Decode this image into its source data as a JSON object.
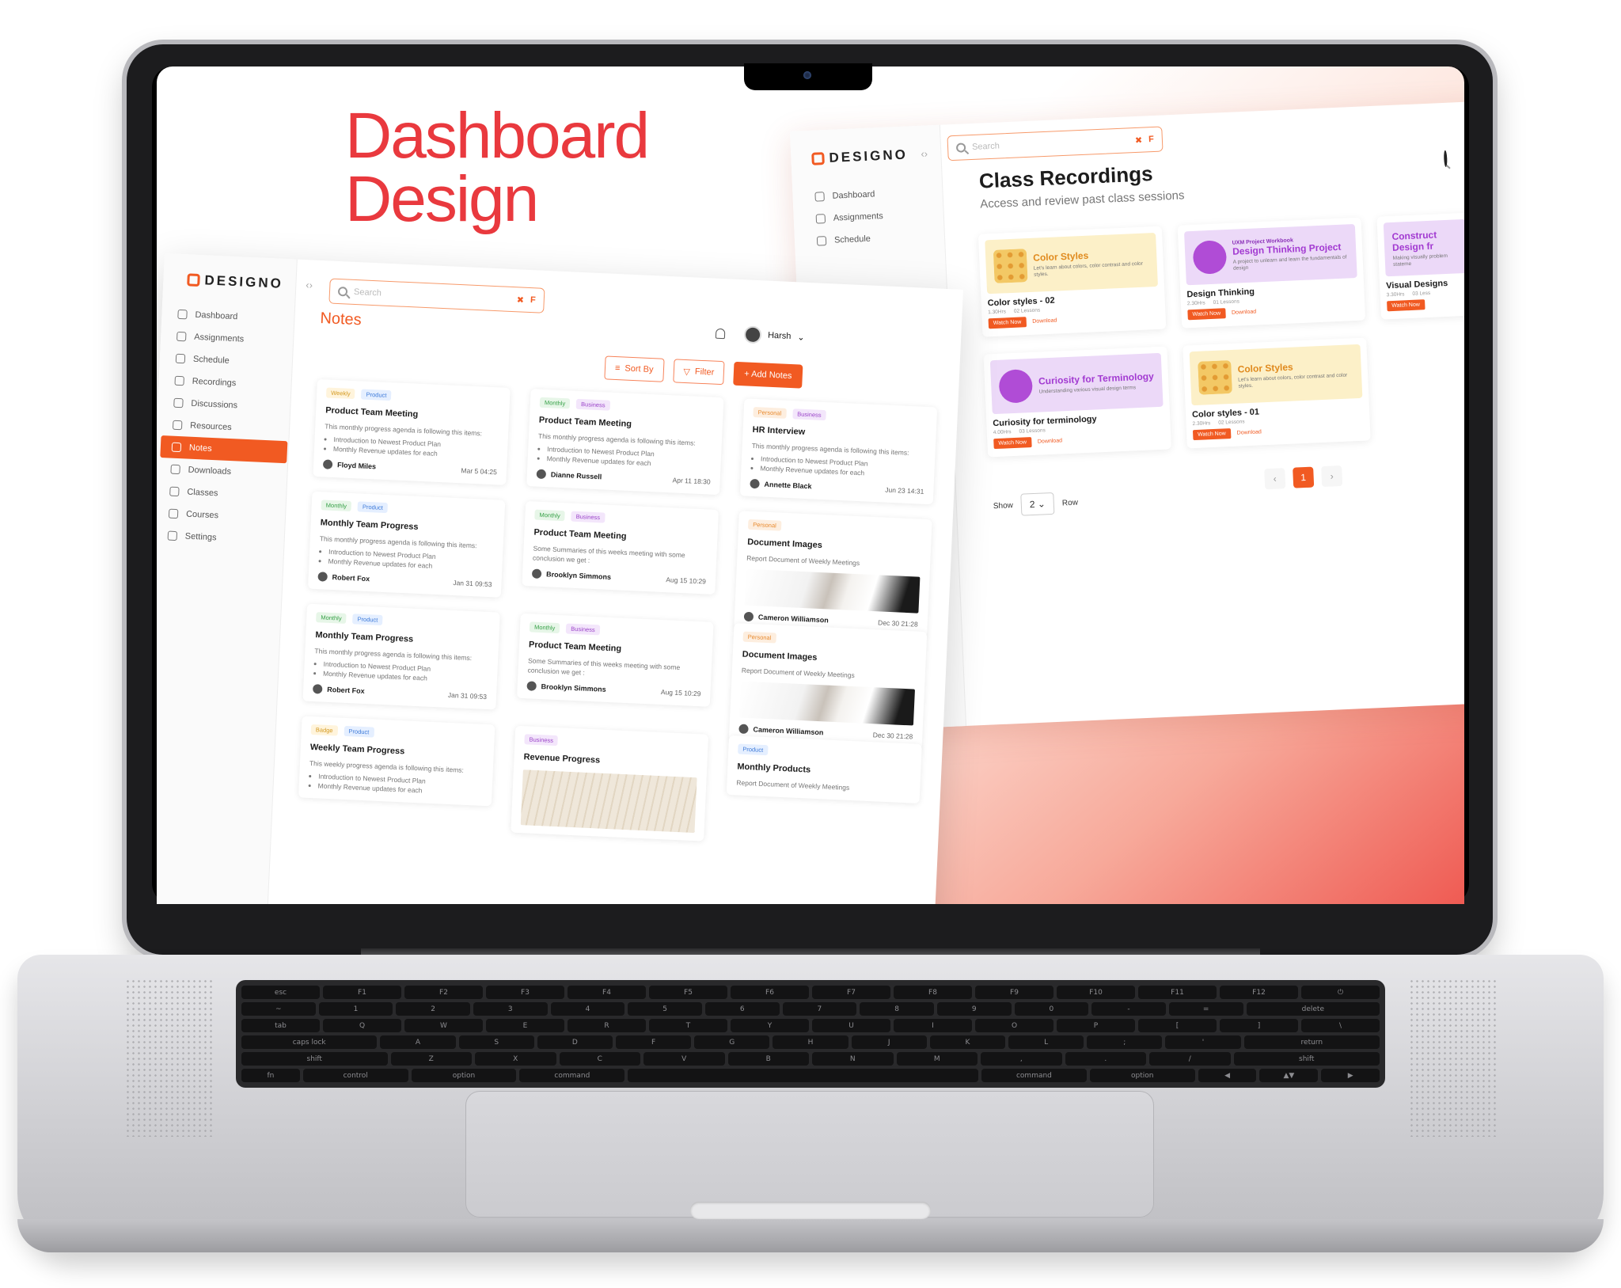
{
  "hero": {
    "line1": "Dashboard",
    "line2": "Design"
  },
  "brand": {
    "name": "DESIGNO",
    "accent": "#f15a22",
    "hero_color": "#e9393e"
  },
  "search": {
    "placeholder": "Search",
    "clear": "✖",
    "shortcut": "F"
  },
  "recordings": {
    "nav": [
      "Dashboard",
      "Assignments",
      "Schedule"
    ],
    "title": "Class Recordings",
    "subtitle": "Access and review past class sessions",
    "cards": [
      {
        "thumb_title": "Color Styles",
        "thumb_desc": "Let's learn about colors, color contrast and color styles.",
        "name": "Color styles - 02",
        "duration": "1.30Hrs",
        "lessons": "02 Lessons",
        "watch": "Watch Now",
        "download": "Download",
        "theme": "yellow"
      },
      {
        "thumb_top": "UXM Project Workbook",
        "thumb_title": "Design Thinking Project",
        "thumb_desc": "A project to unlearn and learn the fundamentals of design",
        "name": "Design Thinking",
        "duration": "2.30Hrs",
        "lessons": "01 Lessons",
        "watch": "Watch Now",
        "download": "Download",
        "theme": "purple"
      },
      {
        "thumb_title": "Construct Design fr",
        "thumb_desc": "Making visually problem stateme",
        "name": "Visual Designs",
        "duration": "3.30Hrs",
        "lessons": "03 Less",
        "watch": "Watch Now",
        "download": "",
        "theme": "purple"
      },
      {
        "thumb_title": "Curiosity for Terminology",
        "thumb_desc": "Understanding various visual design terms",
        "name": "Curiosity for terminology",
        "duration": "4.00Hrs",
        "lessons": "03 Lessons",
        "watch": "Watch Now",
        "download": "Download",
        "theme": "purple"
      },
      {
        "thumb_title": "Color Styles",
        "thumb_desc": "Let's learn about colors, color contrast and color styles.",
        "name": "Color styles - 01",
        "duration": "2.30Hrs",
        "lessons": "02 Lessons",
        "watch": "Watch Now",
        "download": "Download",
        "theme": "yellow"
      }
    ],
    "pager": {
      "prev": "‹",
      "current": "1",
      "next": "›"
    },
    "show": {
      "label": "Show",
      "value": "2",
      "suffix": "Row"
    }
  },
  "notes": {
    "title": "Notes",
    "user": "Harsh",
    "sort": "Sort By",
    "filter": "Filter",
    "add": "+ Add Notes",
    "nav": [
      {
        "label": "Dashboard",
        "icon": "clock-icon",
        "active": false
      },
      {
        "label": "Assignments",
        "icon": "clipboard-icon",
        "active": false
      },
      {
        "label": "Schedule",
        "icon": "calendar-icon",
        "active": false
      },
      {
        "label": "Recordings",
        "icon": "video-icon",
        "active": false
      },
      {
        "label": "Discussions",
        "icon": "chat-icon",
        "active": false
      },
      {
        "label": "Resources",
        "icon": "folder-icon",
        "active": false
      },
      {
        "label": "Notes",
        "icon": "note-icon",
        "active": true
      },
      {
        "label": "Downloads",
        "icon": "download-icon",
        "active": false
      },
      {
        "label": "Classes",
        "icon": "users-icon",
        "active": false
      },
      {
        "label": "Courses",
        "icon": "graduation-icon",
        "active": false
      },
      {
        "label": "Settings",
        "icon": "gear-icon",
        "active": false
      }
    ],
    "items": [
      {
        "tags": [
          "Weekly",
          "Product"
        ],
        "title": "Product Team Meeting",
        "body": "This monthly progress agenda is following this items:",
        "bullets": [
          "Introduction to Newest Product Plan",
          "Monthly Revenue updates for each"
        ],
        "author": "Floyd Miles",
        "date": "Mar 5 04:25"
      },
      {
        "tags": [
          "Monthly",
          "Business"
        ],
        "title": "Product Team Meeting",
        "body": "This monthly progress agenda is following this items:",
        "bullets": [
          "Introduction to Newest Product Plan",
          "Monthly Revenue updates for each"
        ],
        "author": "Dianne Russell",
        "date": "Apr 11 18:30"
      },
      {
        "tags": [
          "Personal",
          "Business"
        ],
        "title": "HR Interview",
        "body": "This monthly progress agenda is following this items:",
        "bullets": [
          "Introduction to Newest Product Plan",
          "Monthly Revenue updates for each"
        ],
        "author": "Annette Black",
        "date": "Jun 23 14:31"
      },
      {
        "tags": [
          "Monthly",
          "Product"
        ],
        "title": "Monthly Team Progress",
        "body": "This monthly progress agenda is following this items:",
        "bullets": [
          "Introduction to Newest Product Plan",
          "Monthly Revenue updates for each"
        ],
        "author": "Robert Fox",
        "date": "Jan 31 09:53"
      },
      {
        "tags": [
          "Monthly",
          "Business"
        ],
        "title": "Product Team Meeting",
        "body": "Some Summaries of this weeks meeting with some conclusion we get :",
        "bullets": [],
        "author": "Brooklyn Simmons",
        "date": "Aug 15 10:29"
      },
      {
        "tags": [
          "Personal"
        ],
        "title": "Document Images",
        "body": "Report Document of Weekly Meetings",
        "bullets": [],
        "author": "Cameron Williamson",
        "date": "Dec 30 21:28"
      },
      {
        "tags": [
          "Monthly",
          "Product"
        ],
        "title": "Monthly Team Progress",
        "body": "This monthly progress agenda is following this items:",
        "bullets": [
          "Introduction to Newest Product Plan",
          "Monthly Revenue updates for each"
        ],
        "author": "Robert Fox",
        "date": "Jan 31 09:53"
      },
      {
        "tags": [
          "Monthly",
          "Business"
        ],
        "title": "Product Team Meeting",
        "body": "Some Summaries of this weeks meeting with some conclusion we get :",
        "bullets": [],
        "author": "Brooklyn Simmons",
        "date": "Aug 15 10:29"
      },
      {
        "tags": [
          "Personal"
        ],
        "title": "Document Images",
        "body": "Report Document of Weekly Meetings",
        "bullets": [],
        "author": "Cameron Williamson",
        "date": "Dec 30 21:28"
      },
      {
        "tags": [
          "Badge",
          "Product"
        ],
        "title": "Weekly Team Progress",
        "body": "This weekly progress agenda is following this items:",
        "bullets": [
          "Introduction to Newest Product Plan",
          "Monthly Revenue updates for each"
        ],
        "author": "",
        "date": ""
      },
      {
        "tags": [
          "Business"
        ],
        "title": "Revenue Progress",
        "body": "",
        "bullets": [],
        "author": "",
        "date": ""
      },
      {
        "tags": [
          "Product"
        ],
        "title": "Monthly Products",
        "body": "Report Document of Weekly Meetings",
        "bullets": [],
        "author": "",
        "date": ""
      }
    ]
  },
  "keyboard": {
    "rows": [
      [
        "esc",
        "F1",
        "F2",
        "F3",
        "F4",
        "F5",
        "F6",
        "F7",
        "F8",
        "F9",
        "F10",
        "F11",
        "F12",
        "⏻"
      ],
      [
        "~",
        "1",
        "2",
        "3",
        "4",
        "5",
        "6",
        "7",
        "8",
        "9",
        "0",
        "-",
        "=",
        "delete"
      ],
      [
        "tab",
        "Q",
        "W",
        "E",
        "R",
        "T",
        "Y",
        "U",
        "I",
        "O",
        "P",
        "[",
        "]",
        "\\"
      ],
      [
        "caps lock",
        "A",
        "S",
        "D",
        "F",
        "G",
        "H",
        "J",
        "K",
        "L",
        ";",
        "'",
        "return"
      ],
      [
        "shift",
        "Z",
        "X",
        "C",
        "V",
        "B",
        "N",
        "M",
        ",",
        ".",
        "/",
        "shift"
      ],
      [
        "fn",
        "control",
        "option",
        "command",
        "",
        "command",
        "option",
        "◀",
        "▲▼",
        "▶"
      ]
    ]
  }
}
